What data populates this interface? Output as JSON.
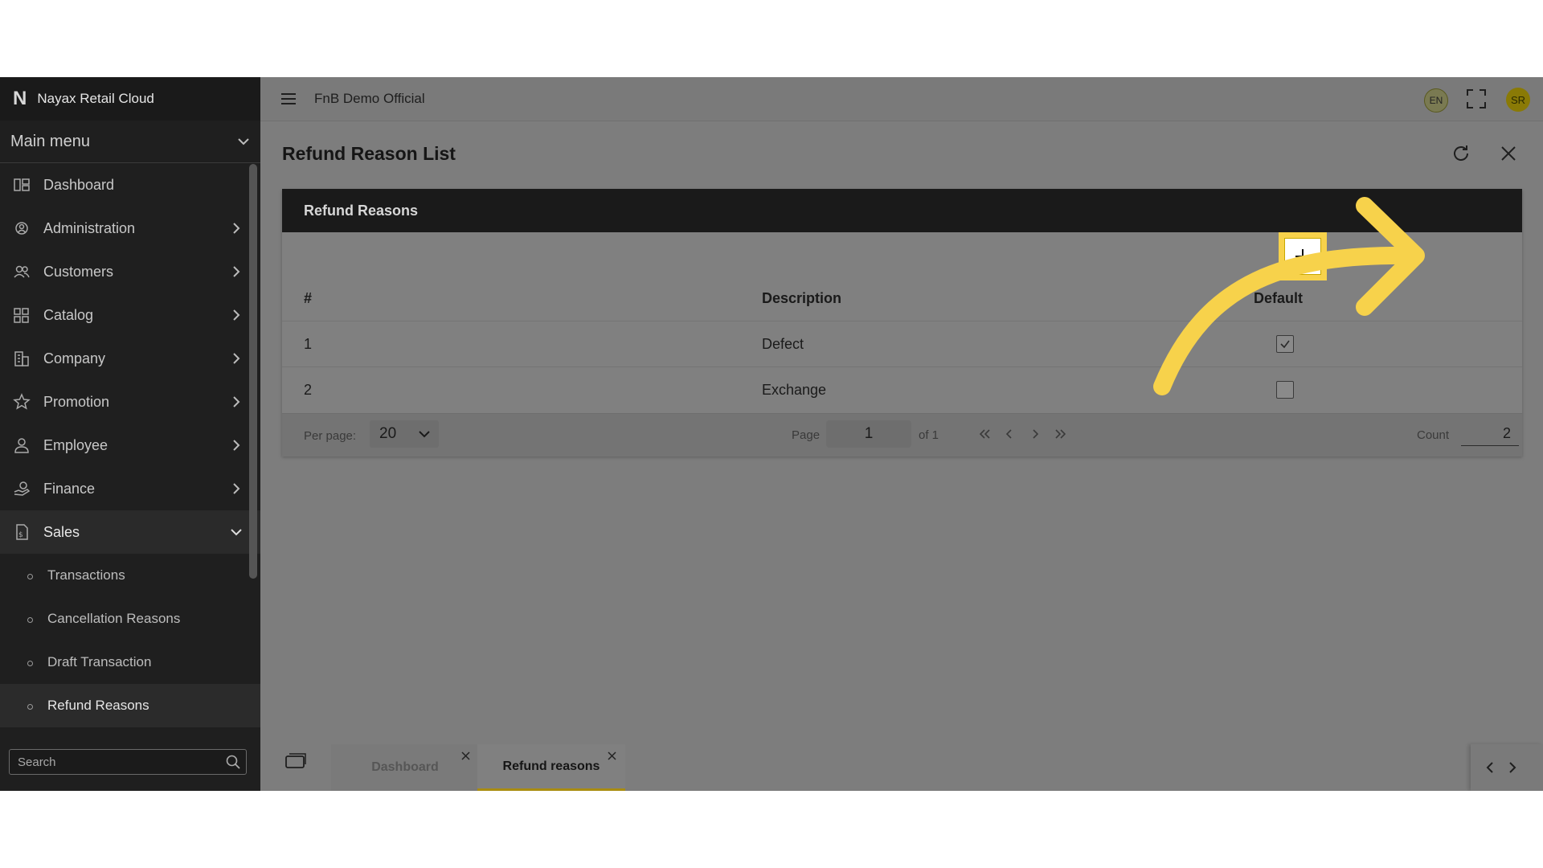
{
  "sidebar": {
    "brand": "Nayax Retail Cloud",
    "brand_logo": "N",
    "main_menu": "Main menu",
    "items": [
      {
        "label": "Dashboard",
        "icon": "dashboard-icon"
      },
      {
        "label": "Administration",
        "icon": "administration-icon"
      },
      {
        "label": "Customers",
        "icon": "customers-icon"
      },
      {
        "label": "Catalog",
        "icon": "catalog-icon"
      },
      {
        "label": "Company",
        "icon": "company-icon"
      },
      {
        "label": "Promotion",
        "icon": "promotion-icon"
      },
      {
        "label": "Employee",
        "icon": "employee-icon"
      },
      {
        "label": "Finance",
        "icon": "finance-icon"
      },
      {
        "label": "Sales",
        "icon": "sales-icon"
      }
    ],
    "sales_sub_items": [
      {
        "label": "Transactions"
      },
      {
        "label": "Cancellation Reasons"
      },
      {
        "label": "Draft Transaction"
      },
      {
        "label": "Refund Reasons"
      }
    ],
    "search_placeholder": "Search"
  },
  "topbar": {
    "store_name": "FnB Demo Official",
    "language": "EN",
    "avatar_initials": "SR"
  },
  "page": {
    "title": "Refund Reason List"
  },
  "card": {
    "title": "Refund Reasons",
    "columns": [
      "#",
      "Description",
      "Default"
    ],
    "rows": [
      {
        "num": "1",
        "description": "Defect",
        "default": true
      },
      {
        "num": "2",
        "description": "Exchange",
        "default": false
      }
    ]
  },
  "pager": {
    "per_page_label": "Per page:",
    "per_page_value": "20",
    "page_label": "Page",
    "page_value": "1",
    "of_label": "of 1",
    "count_label": "Count",
    "count_value": "2"
  },
  "tabs": [
    {
      "label": "Dashboard",
      "active": false
    },
    {
      "label": "Refund reasons",
      "active": true
    }
  ],
  "colors": {
    "highlight": "#f7d24b",
    "annotation_arrow": "#f7d24b",
    "sidebar_bg": "#1f1f1f",
    "overlay_bg": "#7d7d7d"
  }
}
